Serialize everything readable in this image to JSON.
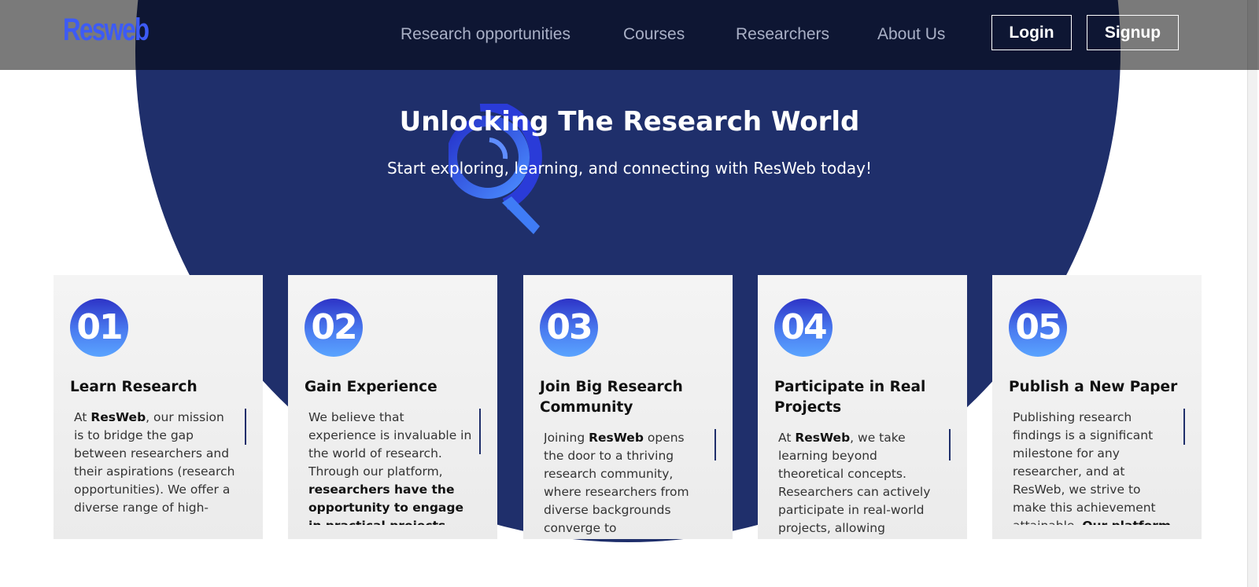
{
  "header": {
    "logo": "Resweb",
    "nav": [
      "Research opportunities",
      "Courses",
      "Researchers",
      "About Us"
    ],
    "login_label": "Login",
    "signup_label": "Signup"
  },
  "hero": {
    "title": "Unlocking The Research World",
    "subtitle": "Start exploring, learning, and connecting with ResWeb today!",
    "icon": "magnifier-icon"
  },
  "colors": {
    "hero_bg": "#1f2f6b",
    "accent": "#3d5bf5",
    "card_bg": "#f1f1f1"
  },
  "cards": [
    {
      "number": "01",
      "title": "Learn Research",
      "body": [
        {
          "t": "At "
        },
        {
          "t": "ResWeb",
          "b": true
        },
        {
          "t": ", our mission is to bridge the gap between researchers and their aspirations (research opportunities). We offer a diverse range of high-"
        }
      ]
    },
    {
      "number": "02",
      "title": "Gain Experience",
      "body": [
        {
          "t": "We believe that experience is invaluable in the world of research. Through our platform, "
        },
        {
          "t": "researchers have the opportunity to engage in practical projects and",
          "b": true
        }
      ]
    },
    {
      "number": "03",
      "title": "Join Big Research Community",
      "body": [
        {
          "t": "Joining "
        },
        {
          "t": "ResWeb",
          "b": true
        },
        {
          "t": " opens the door to a thriving research community, where researchers from diverse backgrounds converge to"
        }
      ]
    },
    {
      "number": "04",
      "title": "Participate in Real Projects",
      "body": [
        {
          "t": "At "
        },
        {
          "t": "ResWeb",
          "b": true
        },
        {
          "t": ", we take learning beyond theoretical concepts. Researchers can actively participate in real-world projects, allowing"
        }
      ]
    },
    {
      "number": "05",
      "title": "Publish a New Paper",
      "body": [
        {
          "t": "Publishing research findings is a significant milestone for any researcher, and at ResWeb, we strive to make this achievement attainable. "
        },
        {
          "t": "Our platform provides",
          "b": true
        }
      ]
    }
  ]
}
